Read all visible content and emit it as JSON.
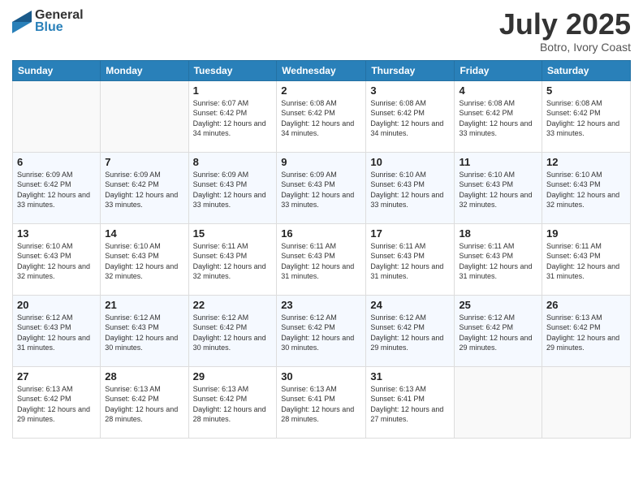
{
  "header": {
    "logo_general": "General",
    "logo_blue": "Blue",
    "month": "July 2025",
    "location": "Botro, Ivory Coast"
  },
  "weekdays": [
    "Sunday",
    "Monday",
    "Tuesday",
    "Wednesday",
    "Thursday",
    "Friday",
    "Saturday"
  ],
  "weeks": [
    [
      {
        "day": "",
        "sunrise": "",
        "sunset": "",
        "daylight": ""
      },
      {
        "day": "",
        "sunrise": "",
        "sunset": "",
        "daylight": ""
      },
      {
        "day": "1",
        "sunrise": "Sunrise: 6:07 AM",
        "sunset": "Sunset: 6:42 PM",
        "daylight": "Daylight: 12 hours and 34 minutes."
      },
      {
        "day": "2",
        "sunrise": "Sunrise: 6:08 AM",
        "sunset": "Sunset: 6:42 PM",
        "daylight": "Daylight: 12 hours and 34 minutes."
      },
      {
        "day": "3",
        "sunrise": "Sunrise: 6:08 AM",
        "sunset": "Sunset: 6:42 PM",
        "daylight": "Daylight: 12 hours and 34 minutes."
      },
      {
        "day": "4",
        "sunrise": "Sunrise: 6:08 AM",
        "sunset": "Sunset: 6:42 PM",
        "daylight": "Daylight: 12 hours and 33 minutes."
      },
      {
        "day": "5",
        "sunrise": "Sunrise: 6:08 AM",
        "sunset": "Sunset: 6:42 PM",
        "daylight": "Daylight: 12 hours and 33 minutes."
      }
    ],
    [
      {
        "day": "6",
        "sunrise": "Sunrise: 6:09 AM",
        "sunset": "Sunset: 6:42 PM",
        "daylight": "Daylight: 12 hours and 33 minutes."
      },
      {
        "day": "7",
        "sunrise": "Sunrise: 6:09 AM",
        "sunset": "Sunset: 6:42 PM",
        "daylight": "Daylight: 12 hours and 33 minutes."
      },
      {
        "day": "8",
        "sunrise": "Sunrise: 6:09 AM",
        "sunset": "Sunset: 6:43 PM",
        "daylight": "Daylight: 12 hours and 33 minutes."
      },
      {
        "day": "9",
        "sunrise": "Sunrise: 6:09 AM",
        "sunset": "Sunset: 6:43 PM",
        "daylight": "Daylight: 12 hours and 33 minutes."
      },
      {
        "day": "10",
        "sunrise": "Sunrise: 6:10 AM",
        "sunset": "Sunset: 6:43 PM",
        "daylight": "Daylight: 12 hours and 33 minutes."
      },
      {
        "day": "11",
        "sunrise": "Sunrise: 6:10 AM",
        "sunset": "Sunset: 6:43 PM",
        "daylight": "Daylight: 12 hours and 32 minutes."
      },
      {
        "day": "12",
        "sunrise": "Sunrise: 6:10 AM",
        "sunset": "Sunset: 6:43 PM",
        "daylight": "Daylight: 12 hours and 32 minutes."
      }
    ],
    [
      {
        "day": "13",
        "sunrise": "Sunrise: 6:10 AM",
        "sunset": "Sunset: 6:43 PM",
        "daylight": "Daylight: 12 hours and 32 minutes."
      },
      {
        "day": "14",
        "sunrise": "Sunrise: 6:10 AM",
        "sunset": "Sunset: 6:43 PM",
        "daylight": "Daylight: 12 hours and 32 minutes."
      },
      {
        "day": "15",
        "sunrise": "Sunrise: 6:11 AM",
        "sunset": "Sunset: 6:43 PM",
        "daylight": "Daylight: 12 hours and 32 minutes."
      },
      {
        "day": "16",
        "sunrise": "Sunrise: 6:11 AM",
        "sunset": "Sunset: 6:43 PM",
        "daylight": "Daylight: 12 hours and 31 minutes."
      },
      {
        "day": "17",
        "sunrise": "Sunrise: 6:11 AM",
        "sunset": "Sunset: 6:43 PM",
        "daylight": "Daylight: 12 hours and 31 minutes."
      },
      {
        "day": "18",
        "sunrise": "Sunrise: 6:11 AM",
        "sunset": "Sunset: 6:43 PM",
        "daylight": "Daylight: 12 hours and 31 minutes."
      },
      {
        "day": "19",
        "sunrise": "Sunrise: 6:11 AM",
        "sunset": "Sunset: 6:43 PM",
        "daylight": "Daylight: 12 hours and 31 minutes."
      }
    ],
    [
      {
        "day": "20",
        "sunrise": "Sunrise: 6:12 AM",
        "sunset": "Sunset: 6:43 PM",
        "daylight": "Daylight: 12 hours and 31 minutes."
      },
      {
        "day": "21",
        "sunrise": "Sunrise: 6:12 AM",
        "sunset": "Sunset: 6:43 PM",
        "daylight": "Daylight: 12 hours and 30 minutes."
      },
      {
        "day": "22",
        "sunrise": "Sunrise: 6:12 AM",
        "sunset": "Sunset: 6:42 PM",
        "daylight": "Daylight: 12 hours and 30 minutes."
      },
      {
        "day": "23",
        "sunrise": "Sunrise: 6:12 AM",
        "sunset": "Sunset: 6:42 PM",
        "daylight": "Daylight: 12 hours and 30 minutes."
      },
      {
        "day": "24",
        "sunrise": "Sunrise: 6:12 AM",
        "sunset": "Sunset: 6:42 PM",
        "daylight": "Daylight: 12 hours and 29 minutes."
      },
      {
        "day": "25",
        "sunrise": "Sunrise: 6:12 AM",
        "sunset": "Sunset: 6:42 PM",
        "daylight": "Daylight: 12 hours and 29 minutes."
      },
      {
        "day": "26",
        "sunrise": "Sunrise: 6:13 AM",
        "sunset": "Sunset: 6:42 PM",
        "daylight": "Daylight: 12 hours and 29 minutes."
      }
    ],
    [
      {
        "day": "27",
        "sunrise": "Sunrise: 6:13 AM",
        "sunset": "Sunset: 6:42 PM",
        "daylight": "Daylight: 12 hours and 29 minutes."
      },
      {
        "day": "28",
        "sunrise": "Sunrise: 6:13 AM",
        "sunset": "Sunset: 6:42 PM",
        "daylight": "Daylight: 12 hours and 28 minutes."
      },
      {
        "day": "29",
        "sunrise": "Sunrise: 6:13 AM",
        "sunset": "Sunset: 6:42 PM",
        "daylight": "Daylight: 12 hours and 28 minutes."
      },
      {
        "day": "30",
        "sunrise": "Sunrise: 6:13 AM",
        "sunset": "Sunset: 6:41 PM",
        "daylight": "Daylight: 12 hours and 28 minutes."
      },
      {
        "day": "31",
        "sunrise": "Sunrise: 6:13 AM",
        "sunset": "Sunset: 6:41 PM",
        "daylight": "Daylight: 12 hours and 27 minutes."
      },
      {
        "day": "",
        "sunrise": "",
        "sunset": "",
        "daylight": ""
      },
      {
        "day": "",
        "sunrise": "",
        "sunset": "",
        "daylight": ""
      }
    ]
  ]
}
